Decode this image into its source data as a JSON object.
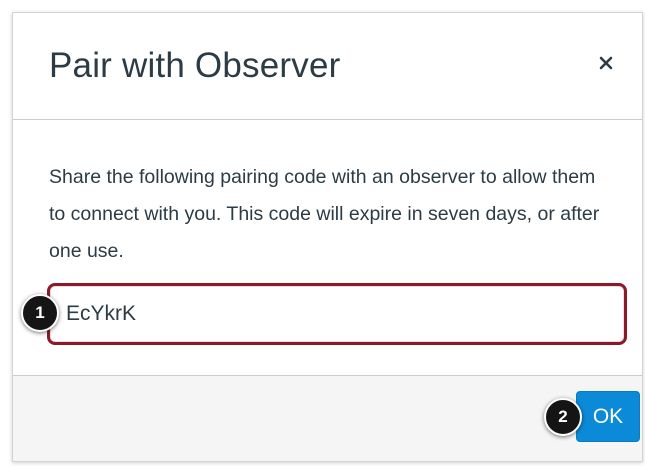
{
  "dialog": {
    "title": "Pair with Observer",
    "close_label": "Close",
    "description": "Share the following pairing code with an observer to allow them to connect with you. This code will expire in seven days, or after one use.",
    "pairing_code": "EcYkrK",
    "ok_label": "OK"
  },
  "callouts": [
    "1",
    "2"
  ],
  "colors": {
    "title_text": "#2d3b45",
    "input_border": "#8b1a28",
    "ok_button": "#0b8ad8",
    "footer_background": "#f5f5f5",
    "callout_background": "#151515"
  },
  "icons": {
    "close": "close-icon"
  }
}
